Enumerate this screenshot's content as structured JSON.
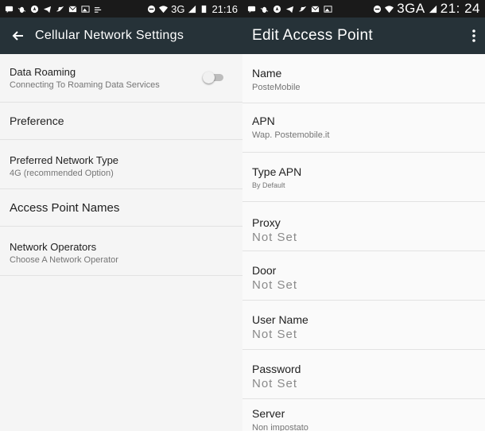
{
  "left_status": {
    "network": "3G",
    "time": "21:16"
  },
  "right_status": {
    "network": "3GA",
    "time": "21: 24"
  },
  "left_screen": {
    "title": "Cellular Network Settings",
    "items": [
      {
        "title": "Data Roaming",
        "subtitle": "Connecting To Roaming Data Services",
        "toggle_on": false
      },
      {
        "title": "Preference"
      },
      {
        "title": "Preferred Network Type",
        "subtitle": "4G (recommended Option)"
      },
      {
        "title": "Access Point Names"
      },
      {
        "title": "Network Operators",
        "subtitle": "Choose A Network Operator"
      }
    ]
  },
  "right_screen": {
    "title": "Edit Access Point",
    "fields": [
      {
        "label": "Name",
        "value": "PosteMobile"
      },
      {
        "label": "APN",
        "value": "Wap. Postemobile.it"
      },
      {
        "label": "Type APN",
        "value": "By Default"
      },
      {
        "label": "Proxy",
        "value": "Not Set"
      },
      {
        "label": "Door",
        "value": "Not Set"
      },
      {
        "label": "User Name",
        "value": "Not Set"
      },
      {
        "label": "Password",
        "value": "Not Set"
      },
      {
        "label": "Server",
        "value": "Non impostato"
      }
    ]
  },
  "colors": {
    "toolbar": "#263238",
    "statusbar": "#1a1a1a",
    "background": "#fafafa",
    "divider": "#e2e2e2"
  }
}
